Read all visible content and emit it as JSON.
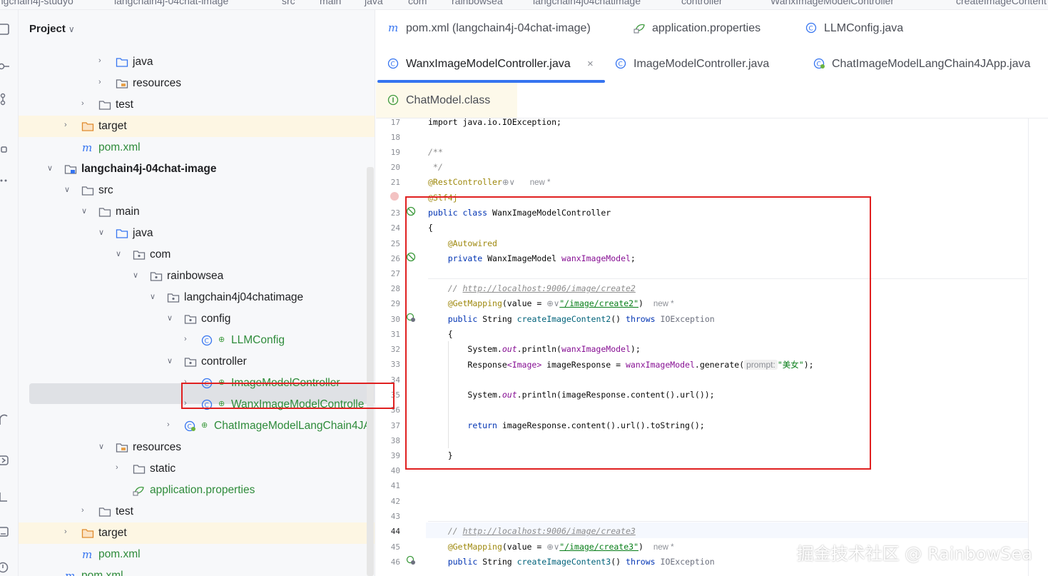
{
  "breadcrumbs": [
    "langchain4j-studyo",
    "langchain4j-04chat-image",
    "src",
    "main",
    "java",
    "com",
    "rainbowsea",
    "langchain4j04chatimage",
    "controller",
    "WanxImageModelController",
    "createImageContent"
  ],
  "project_panel": {
    "title": "Project",
    "tree": [
      {
        "label": "java",
        "icon": "folder-source-icon"
      },
      {
        "label": "resources",
        "icon": "folder-resources-icon"
      },
      {
        "label": "test",
        "icon": "folder-icon"
      },
      {
        "label": "target",
        "icon": "folder-excluded-icon"
      },
      {
        "label": "pom.xml",
        "icon": "maven-icon"
      },
      {
        "label": "langchain4j-04chat-image",
        "icon": "module-icon"
      },
      {
        "label": "src",
        "icon": "folder-icon"
      },
      {
        "label": "main",
        "icon": "folder-icon"
      },
      {
        "label": "java",
        "icon": "folder-source-icon"
      },
      {
        "label": "com",
        "icon": "package-icon"
      },
      {
        "label": "rainbowsea",
        "icon": "package-icon"
      },
      {
        "label": "langchain4j04chatimage",
        "icon": "package-icon"
      },
      {
        "label": "config",
        "icon": "package-icon"
      },
      {
        "label": "LLMConfig",
        "icon": "class-icon"
      },
      {
        "label": "controller",
        "icon": "package-icon"
      },
      {
        "label": "ImageModelController",
        "icon": "class-icon"
      },
      {
        "label": "WanxImageModelControlle",
        "icon": "class-icon"
      },
      {
        "label": "ChatImageModelLangChain4JA",
        "icon": "spring-boot-class-icon"
      },
      {
        "label": "resources",
        "icon": "folder-resources-icon"
      },
      {
        "label": "static",
        "icon": "folder-icon"
      },
      {
        "label": "application.properties",
        "icon": "properties-icon"
      },
      {
        "label": "test",
        "icon": "folder-icon"
      },
      {
        "label": "target",
        "icon": "folder-excluded-icon"
      },
      {
        "label": "pom.xml",
        "icon": "maven-icon"
      },
      {
        "label": "pom.xml",
        "icon": "maven-icon"
      }
    ]
  },
  "tabs": [
    {
      "label": "pom.xml (langchain4j-04chat-image)",
      "icon": "maven-icon"
    },
    {
      "label": "application.properties",
      "icon": "properties-icon"
    },
    {
      "label": "LLMConfig.java",
      "icon": "class-icon"
    },
    {
      "label": "WanxImageModelController.java",
      "icon": "class-icon",
      "active": true,
      "close": "×"
    },
    {
      "label": "ImageModelController.java",
      "icon": "class-icon"
    },
    {
      "label": "ChatImageModelLangChain4JApp.java",
      "icon": "spring-boot-class-icon"
    },
    {
      "label": "ChatModel.class",
      "icon": "interface-icon"
    }
  ],
  "code": {
    "line_numbers": [
      "17",
      "18",
      "19",
      "20",
      "21",
      "23",
      "24",
      "25",
      "26",
      "27",
      "28",
      "29",
      "30",
      "31",
      "32",
      "33",
      "34",
      "35",
      "36",
      "37",
      "38",
      "39",
      "40",
      "41",
      "42",
      "43",
      "44",
      "45",
      "46"
    ],
    "l17": "import java.io.IOException;",
    "l19": "/**",
    "l20": " */",
    "l21_ann": "@RestController",
    "l21_hint": "new *",
    "l22_ann": "@Slf4j",
    "l23_kw": "public class",
    "l23_name": "WanxImageModelController",
    "l24": "{",
    "l25_ann": "@Autowired",
    "l26_kw": "private",
    "l26_type": "WanxImageModel",
    "l26_field": "wanxImageModel",
    "l28_cm": "// ",
    "l28_url": "http://localhost:9006/image/create2",
    "l29_ann": "@GetMapping",
    "l29_pre": "(value = ",
    "l29_str": "\"/image/create2\"",
    "l29_post": ")",
    "l29_hint": "new *",
    "l30_kw": "public",
    "l30_type": "String",
    "l30_method": "createImageContent2",
    "l30_post": "()",
    "l30_throws": "throws",
    "l30_ex": "IOException",
    "l31": "{",
    "l32_a": "System.",
    "l32_b": "out",
    "l32_c": ".println(",
    "l32_d": "wanxImageModel",
    "l32_e": ");",
    "l33_a": "Response",
    "l33_b": "<Image>",
    "l33_c": " imageResponse = ",
    "l33_d": "wanxImageModel",
    "l33_e": ".generate(",
    "l33_hint": "prompt:",
    "l33_str": "\"美女\"",
    "l33_f": ");",
    "l35_a": "System.",
    "l35_b": "out",
    "l35_c": ".println(imageResponse.content().url());",
    "l37_kw": "return",
    "l37_rest": " imageResponse.content().url().toString();",
    "l39": "}",
    "l44_cm": "// ",
    "l44_url": "http://localhost:9006/image/create3",
    "l45_ann": "@GetMapping",
    "l45_pre": "(value = ",
    "l45_str": "\"/image/create3\"",
    "l45_post": ")",
    "l45_hint": "new *",
    "l46_kw": "public",
    "l46_type": "String",
    "l46_method": "createImageContent3",
    "l46_post": "()",
    "l46_throws": "throws",
    "l46_ex": "IOException"
  },
  "watermark": "掘金技术社区 @ RainbowSea",
  "colors": {
    "accent": "#3574f0",
    "highlight_box": "#e02020",
    "excluded_folder_bg": "#fdf6e3"
  }
}
